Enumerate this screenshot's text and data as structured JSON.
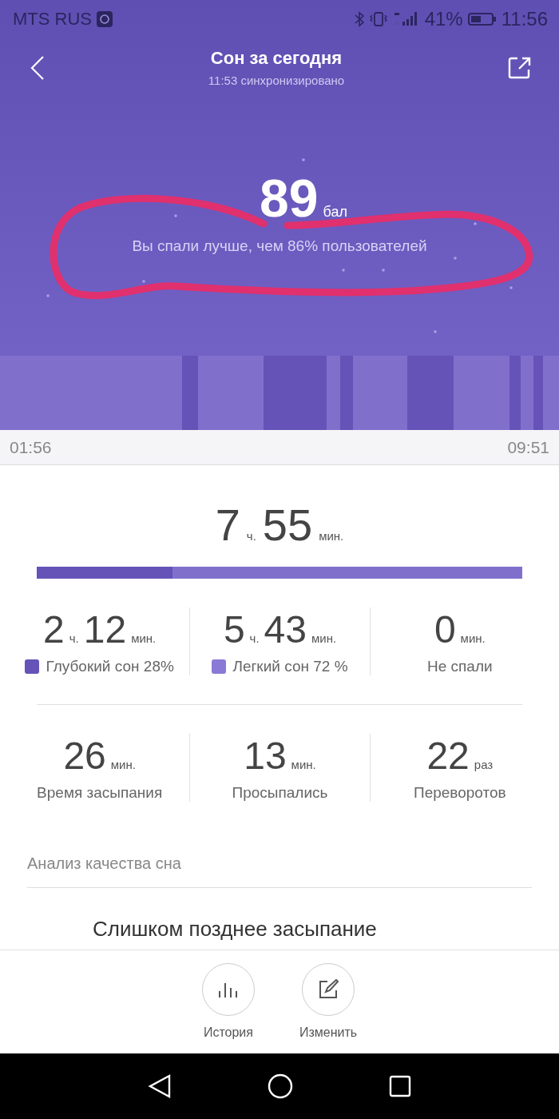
{
  "status_bar": {
    "carrier": "MTS RUS",
    "battery_text": "41%",
    "time": "11:56"
  },
  "header": {
    "title": "Сон за сегодня",
    "subtitle": "11:53 синхронизировано"
  },
  "score": {
    "value": "89",
    "unit": "бал",
    "comparison": "Вы спали лучше, чем 86% пользователей"
  },
  "sleep_chart": {
    "segments": [
      {
        "kind": "light"
      },
      {
        "kind": "deep"
      },
      {
        "kind": "light"
      },
      {
        "kind": "deep"
      },
      {
        "kind": "light"
      },
      {
        "kind": "deep"
      },
      {
        "kind": "light"
      },
      {
        "kind": "deep"
      },
      {
        "kind": "light"
      },
      {
        "kind": "deep"
      },
      {
        "kind": "light"
      },
      {
        "kind": "deep"
      },
      {
        "kind": "light"
      }
    ],
    "start": "01:56",
    "end": "09:51"
  },
  "total": {
    "hours": "7",
    "hours_unit": "ч.",
    "minutes": "55",
    "minutes_unit": "мин.",
    "deep_share": {
      "level": 0.28
    }
  },
  "phases": [
    {
      "hours": "2",
      "hours_unit": "ч.",
      "minutes": "12",
      "minutes_unit": "мин.",
      "label": "Глубокий сон 28%",
      "color": "#6653b8"
    },
    {
      "hours": "5",
      "hours_unit": "ч.",
      "minutes": "43",
      "minutes_unit": "мин.",
      "label": "Легкий сон 72 %",
      "color": "#8a7ad6"
    },
    {
      "minutes": "0",
      "minutes_unit": "мин.",
      "label": "Не спали"
    }
  ],
  "stats": [
    {
      "value": "26",
      "unit": "мин.",
      "label": "Время засыпания"
    },
    {
      "value": "13",
      "unit": "мин.",
      "label": "Просыпались"
    },
    {
      "value": "22",
      "unit": "раз",
      "label": "Переворотов"
    }
  ],
  "analysis": {
    "heading": "Анализ качества сна",
    "item_title": "Слишком позднее засыпание"
  },
  "bottom_actions": [
    {
      "kind": "history",
      "label": "История"
    },
    {
      "kind": "edit",
      "label": "Изменить"
    }
  ]
}
